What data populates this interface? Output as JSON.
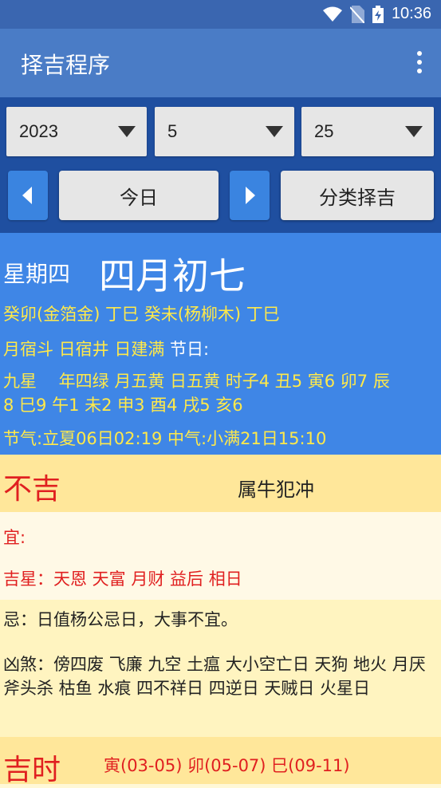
{
  "status_bar": {
    "time": "10:36",
    "icons": [
      "wifi-icon",
      "no-sim-icon",
      "battery-charging-icon"
    ]
  },
  "app_bar": {
    "title": "择吉程序",
    "menu_icon": "more-vert-icon"
  },
  "controls": {
    "year": "2023",
    "month": "5",
    "day": "25",
    "today_label": "今日",
    "category_label": "分类择吉"
  },
  "info": {
    "weekday": "星期四",
    "lunar_date": "四月初七",
    "ganzhi": "癸卯(金箔金) 丁巳 癸未(杨柳木) 丁巳",
    "mansion": "月宿斗 日宿井 日建满",
    "festival_label": "节日:",
    "festival_value": "",
    "nine_star_line1": "九星　 年四绿 月五黄 日五黄 时子4 丑5 寅6 卯7 辰",
    "nine_star_line2": "8 巳9 午1 未2 申3 酉4 戌5 亥6",
    "solar_terms": "节气:立夏06日02:19 中气:小满21日15:10"
  },
  "verdict": {
    "label": "不吉",
    "clash": "属牛犯冲"
  },
  "suitable": {
    "label": "宜:",
    "value": ""
  },
  "lucky_stars": "吉星：天恩 天富 月财 益后 相日",
  "avoid": "忌：日值杨公忌日，大事不宜。",
  "evil_stars": "凶煞：傍四废 飞廉 九空 土瘟 大小空亡日 天狗 地火 月厌 斧头杀 枯鱼 水痕 四不祥日 四逆日 天贼日 火星日",
  "lucky_hours": {
    "label": "吉时",
    "value": "寅(03-05) 卯(05-07) 巳(09-11)"
  }
}
